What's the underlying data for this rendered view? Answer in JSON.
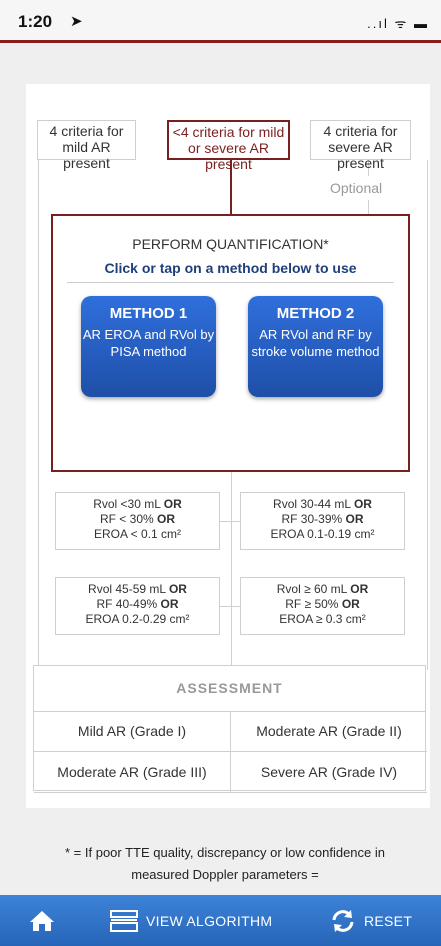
{
  "status": {
    "time": "1:20",
    "arrow": "➤",
    "icons": "..ıl ᯤ ▬"
  },
  "criteria": {
    "mild": "4 criteria for mild AR present",
    "middle": "<4 criteria for mild or severe AR present",
    "severe": "4 criteria for severe AR present"
  },
  "optional_label": "Optional",
  "quantification": {
    "title": "PERFORM QUANTIFICATION*",
    "subtitle": "Click or tap on a method below to use",
    "methods": [
      {
        "title": "METHOD 1",
        "desc": "AR EROA and RVol by PISA method"
      },
      {
        "title": "METHOD 2",
        "desc": "AR RVol and RF by stroke volume method"
      }
    ]
  },
  "volumes": [
    {
      "l1": "Rvol <30 mL",
      "l2": "RF < 30%",
      "l3": "EROA < 0.1 cm²"
    },
    {
      "l1": "Rvol 30-44 mL",
      "l2": "RF 30-39%",
      "l3": "EROA 0.1-0.19 cm²"
    },
    {
      "l1": "Rvol 45-59 mL",
      "l2": "RF 40-49%",
      "l3": "EROA 0.2-0.29 cm²"
    },
    {
      "l1": "Rvol ≥ 60 mL",
      "l2": "RF ≥ 50%",
      "l3": "EROA ≥ 0.3 cm²"
    }
  ],
  "or_word": "OR",
  "assessment": {
    "title": "ASSESSMENT",
    "cells": [
      "Mild AR (Grade I)",
      "Moderate AR (Grade II)",
      "Moderate AR (Grade III)",
      "Severe AR (Grade IV)"
    ]
  },
  "footnote": "* = If poor TTE quality, discrepancy or low confidence in measured Doppler parameters =",
  "toolbar": {
    "view": "VIEW ALGORITHM",
    "reset": "RESET"
  },
  "colors": {
    "accent": "#2665b8",
    "border_dark": "#7a1f1f",
    "method_blue": "#1f4fa8"
  }
}
